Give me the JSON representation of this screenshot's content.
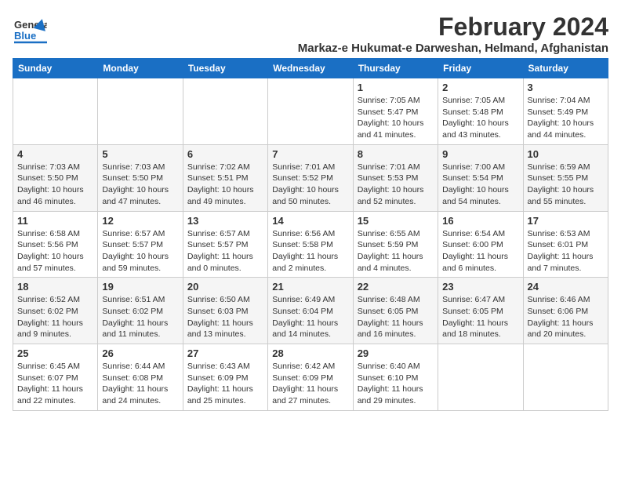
{
  "header": {
    "logo_general": "General",
    "logo_blue": "Blue",
    "title": "February 2024",
    "subtitle": "Markaz-e Hukumat-e Darweshan, Helmand, Afghanistan"
  },
  "days_of_week": [
    "Sunday",
    "Monday",
    "Tuesday",
    "Wednesday",
    "Thursday",
    "Friday",
    "Saturday"
  ],
  "weeks": [
    [
      {
        "day": "",
        "details": ""
      },
      {
        "day": "",
        "details": ""
      },
      {
        "day": "",
        "details": ""
      },
      {
        "day": "",
        "details": ""
      },
      {
        "day": "1",
        "details": "Sunrise: 7:05 AM\nSunset: 5:47 PM\nDaylight: 10 hours\nand 41 minutes."
      },
      {
        "day": "2",
        "details": "Sunrise: 7:05 AM\nSunset: 5:48 PM\nDaylight: 10 hours\nand 43 minutes."
      },
      {
        "day": "3",
        "details": "Sunrise: 7:04 AM\nSunset: 5:49 PM\nDaylight: 10 hours\nand 44 minutes."
      }
    ],
    [
      {
        "day": "4",
        "details": "Sunrise: 7:03 AM\nSunset: 5:50 PM\nDaylight: 10 hours\nand 46 minutes."
      },
      {
        "day": "5",
        "details": "Sunrise: 7:03 AM\nSunset: 5:50 PM\nDaylight: 10 hours\nand 47 minutes."
      },
      {
        "day": "6",
        "details": "Sunrise: 7:02 AM\nSunset: 5:51 PM\nDaylight: 10 hours\nand 49 minutes."
      },
      {
        "day": "7",
        "details": "Sunrise: 7:01 AM\nSunset: 5:52 PM\nDaylight: 10 hours\nand 50 minutes."
      },
      {
        "day": "8",
        "details": "Sunrise: 7:01 AM\nSunset: 5:53 PM\nDaylight: 10 hours\nand 52 minutes."
      },
      {
        "day": "9",
        "details": "Sunrise: 7:00 AM\nSunset: 5:54 PM\nDaylight: 10 hours\nand 54 minutes."
      },
      {
        "day": "10",
        "details": "Sunrise: 6:59 AM\nSunset: 5:55 PM\nDaylight: 10 hours\nand 55 minutes."
      }
    ],
    [
      {
        "day": "11",
        "details": "Sunrise: 6:58 AM\nSunset: 5:56 PM\nDaylight: 10 hours\nand 57 minutes."
      },
      {
        "day": "12",
        "details": "Sunrise: 6:57 AM\nSunset: 5:57 PM\nDaylight: 10 hours\nand 59 minutes."
      },
      {
        "day": "13",
        "details": "Sunrise: 6:57 AM\nSunset: 5:57 PM\nDaylight: 11 hours\nand 0 minutes."
      },
      {
        "day": "14",
        "details": "Sunrise: 6:56 AM\nSunset: 5:58 PM\nDaylight: 11 hours\nand 2 minutes."
      },
      {
        "day": "15",
        "details": "Sunrise: 6:55 AM\nSunset: 5:59 PM\nDaylight: 11 hours\nand 4 minutes."
      },
      {
        "day": "16",
        "details": "Sunrise: 6:54 AM\nSunset: 6:00 PM\nDaylight: 11 hours\nand 6 minutes."
      },
      {
        "day": "17",
        "details": "Sunrise: 6:53 AM\nSunset: 6:01 PM\nDaylight: 11 hours\nand 7 minutes."
      }
    ],
    [
      {
        "day": "18",
        "details": "Sunrise: 6:52 AM\nSunset: 6:02 PM\nDaylight: 11 hours\nand 9 minutes."
      },
      {
        "day": "19",
        "details": "Sunrise: 6:51 AM\nSunset: 6:02 PM\nDaylight: 11 hours\nand 11 minutes."
      },
      {
        "day": "20",
        "details": "Sunrise: 6:50 AM\nSunset: 6:03 PM\nDaylight: 11 hours\nand 13 minutes."
      },
      {
        "day": "21",
        "details": "Sunrise: 6:49 AM\nSunset: 6:04 PM\nDaylight: 11 hours\nand 14 minutes."
      },
      {
        "day": "22",
        "details": "Sunrise: 6:48 AM\nSunset: 6:05 PM\nDaylight: 11 hours\nand 16 minutes."
      },
      {
        "day": "23",
        "details": "Sunrise: 6:47 AM\nSunset: 6:05 PM\nDaylight: 11 hours\nand 18 minutes."
      },
      {
        "day": "24",
        "details": "Sunrise: 6:46 AM\nSunset: 6:06 PM\nDaylight: 11 hours\nand 20 minutes."
      }
    ],
    [
      {
        "day": "25",
        "details": "Sunrise: 6:45 AM\nSunset: 6:07 PM\nDaylight: 11 hours\nand 22 minutes."
      },
      {
        "day": "26",
        "details": "Sunrise: 6:44 AM\nSunset: 6:08 PM\nDaylight: 11 hours\nand 24 minutes."
      },
      {
        "day": "27",
        "details": "Sunrise: 6:43 AM\nSunset: 6:09 PM\nDaylight: 11 hours\nand 25 minutes."
      },
      {
        "day": "28",
        "details": "Sunrise: 6:42 AM\nSunset: 6:09 PM\nDaylight: 11 hours\nand 27 minutes."
      },
      {
        "day": "29",
        "details": "Sunrise: 6:40 AM\nSunset: 6:10 PM\nDaylight: 11 hours\nand 29 minutes."
      },
      {
        "day": "",
        "details": ""
      },
      {
        "day": "",
        "details": ""
      }
    ]
  ]
}
